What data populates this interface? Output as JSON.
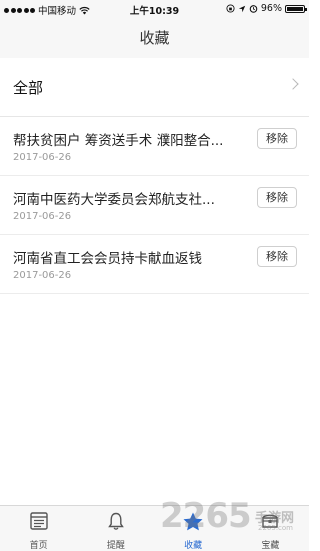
{
  "status_bar": {
    "carrier": "中国移动",
    "time": "上午10:39",
    "battery": "96%",
    "icons": [
      "signal-dots",
      "wifi-icon",
      "orientation-lock-icon",
      "location-arrow-icon",
      "alarm-icon",
      "battery-icon"
    ]
  },
  "header": {
    "title": "收藏"
  },
  "filter": {
    "label": "全部"
  },
  "favorites": [
    {
      "title": "帮扶贫困户 筹资送手术 濮阳整合...",
      "date": "2017-06-26",
      "action": "移除"
    },
    {
      "title": "河南中医药大学委员会郑航支社...",
      "date": "2017-06-26",
      "action": "移除"
    },
    {
      "title": "河南省直工会会员持卡献血返钱",
      "date": "2017-06-26",
      "action": "移除"
    }
  ],
  "tabs": [
    {
      "label": "首页",
      "icon": "news-icon",
      "active": false
    },
    {
      "label": "提醒",
      "icon": "bell-icon",
      "active": false
    },
    {
      "label": "收藏",
      "icon": "star-icon",
      "active": true
    },
    {
      "label": "宝藏",
      "icon": "treasure-icon",
      "active": false
    }
  ],
  "watermark": {
    "text": "2265",
    "sub": "手游网",
    "url": "2265.com"
  },
  "colors": {
    "accent": "#2a6bd1",
    "background": "#f7f7f7"
  }
}
